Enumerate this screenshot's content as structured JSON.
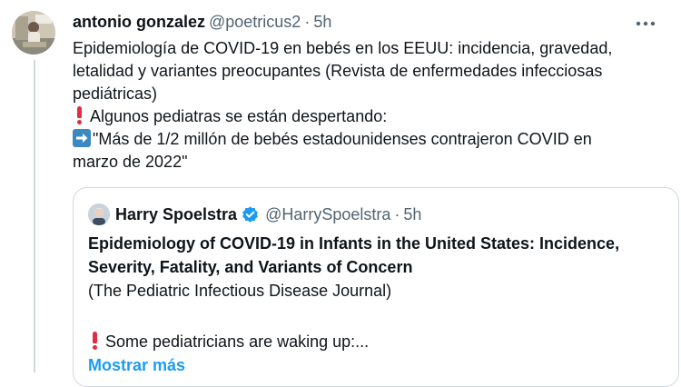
{
  "tweet": {
    "display_name": "antonio gonzalez",
    "handle": "@poetricus2",
    "separator": "·",
    "time": "5h",
    "line1": "Epidemiología de COVID-19 en bebés en los EEUU: incidencia, gravedad,",
    "line2": "letalidad y variantes preocupantes (Revista de enfermedades infecciosas",
    "line3": "pediátricas)",
    "line4": "Algunos pediatras se están despertando:",
    "line5": "\"Más de 1/2 millón de bebés estadounidenses contrajeron COVID en",
    "line6": "marzo de 2022\"",
    "icons": {
      "more": "more-horizontal-icon",
      "exclamation": "red-exclamation-emoji-icon",
      "arrow": "right-arrow-emoji-icon"
    }
  },
  "quoted": {
    "display_name": "Harry Spoelstra",
    "handle": "@HarrySpoelstra",
    "separator": "·",
    "time": "5h",
    "title_line1": "Epidemiology of COVID-19 in Infants in the United States: Incidence,",
    "title_line2": "Severity, Fatality, and Variants of Concern",
    "subtitle": "(The Pediatric Infectious Disease Journal)",
    "line_bottom": "Some pediatricians are waking up:...",
    "show_more": "Mostrar más",
    "icons": {
      "verified": "verified-badge-icon"
    }
  },
  "colors": {
    "text": "#0f1419",
    "secondary": "#536471",
    "accent": "#1d9bf0",
    "border": "#cfd9de",
    "emoji_red": "#dd2e44",
    "emoji_blue": "#3b88c3"
  }
}
